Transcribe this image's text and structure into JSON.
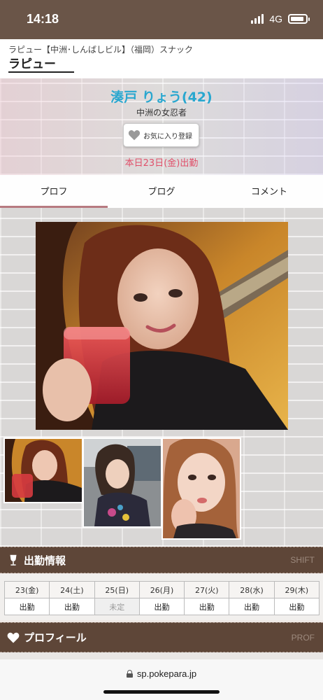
{
  "status_bar": {
    "time": "14:18",
    "network": "4G",
    "battery_percent": 90
  },
  "shop": {
    "breadcrumb": "ラピュー【中洲･しんばしビル】（福岡）スナック",
    "name": "ラピュー"
  },
  "cast": {
    "name": "湊戸 りょう(42)",
    "catchphrase": "中洲の女忍者",
    "favorite_button": "お気に入り登録",
    "today": "本日23日(金)出勤"
  },
  "tabs": [
    {
      "label": "プロフ",
      "active": true
    },
    {
      "label": "ブログ",
      "active": false
    },
    {
      "label": "コメント",
      "active": false
    }
  ],
  "photos": {
    "main": "cast-photo-main",
    "thumbs": [
      "cast-photo-thumb-1",
      "cast-photo-thumb-2",
      "cast-photo-thumb-3"
    ]
  },
  "schedule_section": {
    "title": "出勤情報",
    "en": "SHIFT",
    "icon": "wine-glass-icon"
  },
  "schedule": {
    "days": [
      {
        "label": "23(金)",
        "status": "出勤",
        "type": "weekday"
      },
      {
        "label": "24(土)",
        "status": "出勤",
        "type": "sat"
      },
      {
        "label": "25(日)",
        "status": "未定",
        "type": "sun"
      },
      {
        "label": "26(月)",
        "status": "出勤",
        "type": "weekday"
      },
      {
        "label": "27(火)",
        "status": "出勤",
        "type": "weekday"
      },
      {
        "label": "28(水)",
        "status": "出勤",
        "type": "weekday"
      },
      {
        "label": "29(木)",
        "status": "出勤",
        "type": "weekday"
      }
    ]
  },
  "profile_section": {
    "title": "プロフィール",
    "en": "PROF",
    "icon": "heart-icon"
  },
  "browser": {
    "url": "sp.pokepara.jp"
  },
  "colors": {
    "accent_blue": "#29a7cf",
    "accent_pink": "#e0506a",
    "header_brown": "#5e4638",
    "tab_underline": "#b77a80"
  }
}
